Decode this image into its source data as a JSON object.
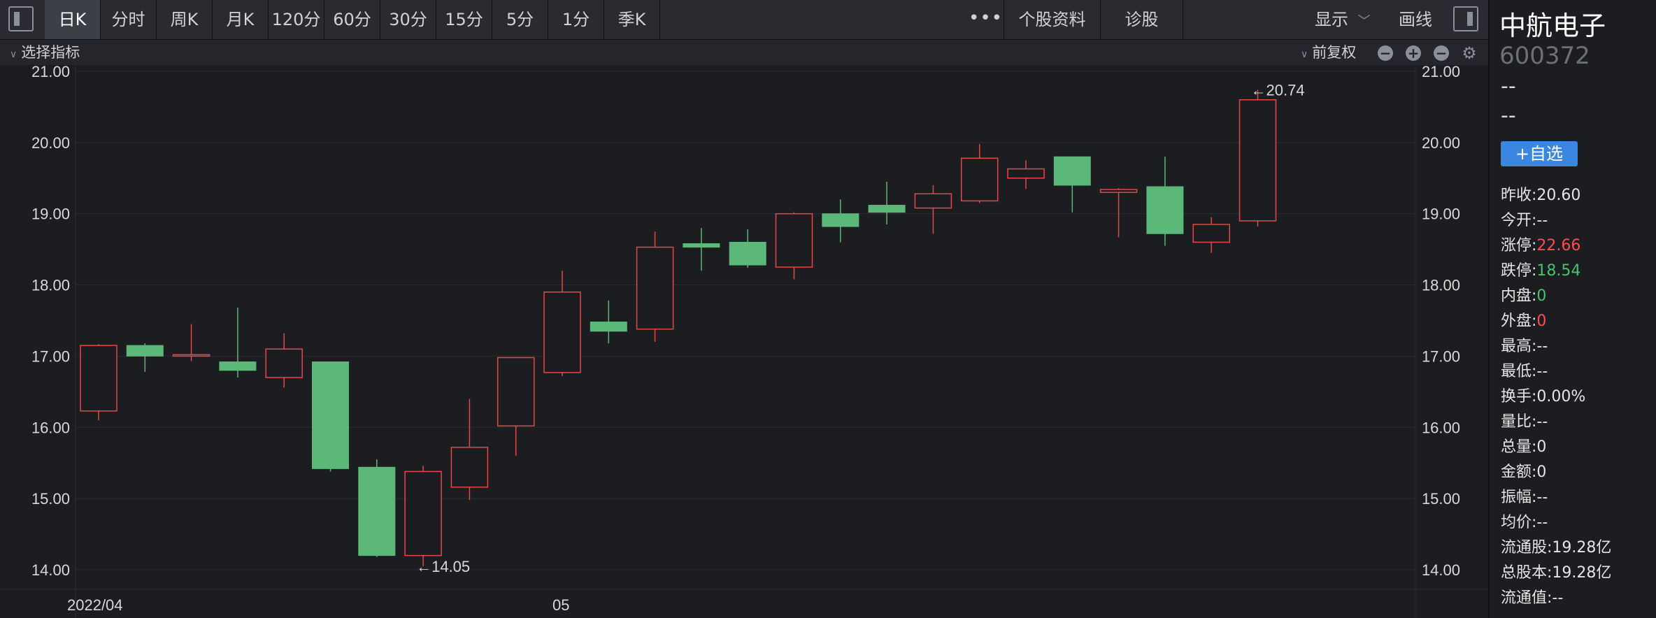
{
  "toolbar": {
    "tabs": [
      {
        "label": "日K",
        "active": true
      },
      {
        "label": "分时",
        "active": false
      },
      {
        "label": "周K",
        "active": false
      },
      {
        "label": "月K",
        "active": false
      },
      {
        "label": "120分",
        "active": false
      },
      {
        "label": "60分",
        "active": false
      },
      {
        "label": "30分",
        "active": false
      },
      {
        "label": "15分",
        "active": false
      },
      {
        "label": "5分",
        "active": false
      },
      {
        "label": "1分",
        "active": false
      },
      {
        "label": "季K",
        "active": false
      }
    ],
    "more_label": "•••",
    "extra_tabs": [
      {
        "label": "个股资料"
      },
      {
        "label": "诊股"
      }
    ],
    "display_label": "显示",
    "draw_label": "画线"
  },
  "subbar": {
    "indicator_label": "选择指标",
    "adjust_label": "前复权",
    "buttons": [
      "minus-icon",
      "plus-icon",
      "minus-icon",
      "gear-icon"
    ]
  },
  "stock": {
    "name": "中航电子",
    "code": "600372",
    "price": "--",
    "change": "--",
    "add_watch_label": "+自选"
  },
  "quote": [
    {
      "label": "昨收:",
      "value": "20.60",
      "color": "normal"
    },
    {
      "label": "今开:",
      "value": "--",
      "color": "normal"
    },
    {
      "label": "涨停:",
      "value": "22.66",
      "color": "up"
    },
    {
      "label": "跌停:",
      "value": "18.54",
      "color": "down"
    },
    {
      "label": "内盘:",
      "value": "0",
      "color": "down"
    },
    {
      "label": "外盘:",
      "value": "0",
      "color": "up"
    },
    {
      "label": "最高:",
      "value": "--",
      "color": "normal"
    },
    {
      "label": "最低:",
      "value": "--",
      "color": "normal"
    },
    {
      "label": "换手:",
      "value": "0.00%",
      "color": "normal"
    },
    {
      "label": "量比:",
      "value": "--",
      "color": "normal"
    },
    {
      "label": "总量:",
      "value": "0",
      "color": "normal"
    },
    {
      "label": "金额:",
      "value": "0",
      "color": "normal"
    },
    {
      "label": "振幅:",
      "value": "--",
      "color": "normal"
    },
    {
      "label": "均价:",
      "value": "--",
      "color": "normal"
    },
    {
      "label": "流通股:",
      "value": "19.28亿",
      "color": "normal"
    },
    {
      "label": "总股本:",
      "value": "19.28亿",
      "color": "normal"
    },
    {
      "label": "流通值:",
      "value": "--",
      "color": "normal"
    }
  ],
  "colors": {
    "up": "#ff4d4d",
    "down": "#4bc06e",
    "candle_up": "#e84646",
    "candle_down": "#5cb878",
    "grid": "#2c2d33",
    "axis_text": "#d9d9d9",
    "accent": "#3a86e0"
  },
  "chart_data": {
    "type": "candlestick",
    "y_ticks": [
      "21.00",
      "20.00",
      "19.00",
      "18.00",
      "17.00",
      "16.00",
      "15.00",
      "14.00"
    ],
    "ylim": [
      13.85,
      21.1
    ],
    "x_labels": [
      {
        "index": 0,
        "label": "2022/04"
      },
      {
        "index": 10,
        "label": "05"
      }
    ],
    "candles": [
      {
        "open": 16.23,
        "close": 17.15,
        "high": 17.17,
        "low": 16.1
      },
      {
        "open": 17.15,
        "close": 17.0,
        "high": 17.18,
        "low": 16.78
      },
      {
        "open": 17.0,
        "close": 17.02,
        "high": 17.45,
        "low": 16.93
      },
      {
        "open": 16.92,
        "close": 16.8,
        "high": 17.68,
        "low": 16.7
      },
      {
        "open": 16.7,
        "close": 17.1,
        "high": 17.32,
        "low": 16.56
      },
      {
        "open": 16.92,
        "close": 15.42,
        "high": 16.92,
        "low": 15.38
      },
      {
        "open": 15.44,
        "close": 14.2,
        "high": 15.55,
        "low": 14.18
      },
      {
        "open": 14.2,
        "close": 15.38,
        "high": 15.46,
        "low": 14.05
      },
      {
        "open": 15.16,
        "close": 15.72,
        "high": 16.4,
        "low": 14.98
      },
      {
        "open": 16.02,
        "close": 16.98,
        "high": 16.99,
        "low": 15.6
      },
      {
        "open": 16.77,
        "close": 17.9,
        "high": 18.2,
        "low": 16.72
      },
      {
        "open": 17.48,
        "close": 17.35,
        "high": 17.78,
        "low": 17.18
      },
      {
        "open": 17.38,
        "close": 18.53,
        "high": 18.75,
        "low": 17.2
      },
      {
        "open": 18.58,
        "close": 18.53,
        "high": 18.8,
        "low": 18.2
      },
      {
        "open": 18.6,
        "close": 18.28,
        "high": 18.78,
        "low": 18.24
      },
      {
        "open": 18.25,
        "close": 19.0,
        "high": 19.02,
        "low": 18.08
      },
      {
        "open": 19.0,
        "close": 18.82,
        "high": 19.2,
        "low": 18.6
      },
      {
        "open": 19.12,
        "close": 19.02,
        "high": 19.45,
        "low": 18.85
      },
      {
        "open": 19.08,
        "close": 19.28,
        "high": 19.4,
        "low": 18.72
      },
      {
        "open": 19.18,
        "close": 19.78,
        "high": 19.98,
        "low": 19.15
      },
      {
        "open": 19.5,
        "close": 19.63,
        "high": 19.75,
        "low": 19.35
      },
      {
        "open": 19.8,
        "close": 19.4,
        "high": 19.8,
        "low": 19.02
      },
      {
        "open": 19.3,
        "close": 19.34,
        "high": 19.36,
        "low": 18.67
      },
      {
        "open": 19.38,
        "close": 18.72,
        "high": 19.8,
        "low": 18.55
      },
      {
        "open": 18.6,
        "close": 18.85,
        "high": 18.95,
        "low": 18.45
      },
      {
        "open": 18.9,
        "close": 20.6,
        "high": 20.74,
        "low": 18.82
      }
    ],
    "annotations": [
      {
        "index": 25,
        "value": 20.74,
        "label": "←20.74"
      },
      {
        "index": 7,
        "value": 14.05,
        "label": "←14.05"
      }
    ]
  }
}
